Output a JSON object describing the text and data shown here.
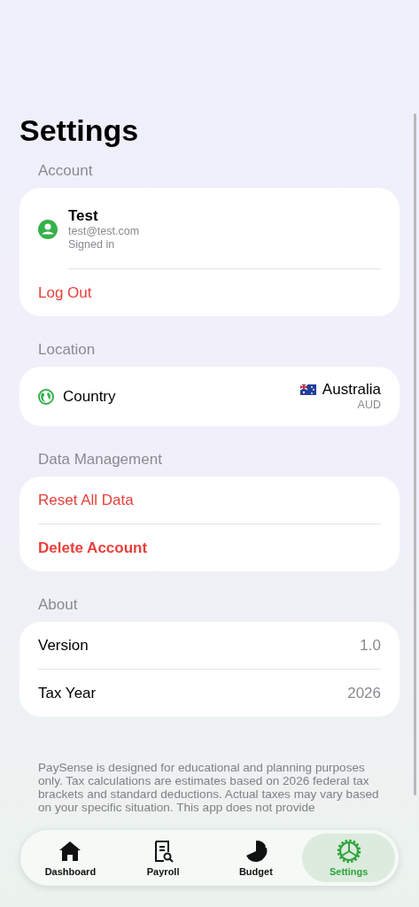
{
  "title": "Settings",
  "sections": [
    {
      "header": "Account",
      "rows": [
        {
          "kind": "profile",
          "name": "Test",
          "email": "test@test.com",
          "status": "Signed in"
        },
        {
          "kind": "action",
          "label": "Log Out",
          "bold": false
        }
      ]
    },
    {
      "header": "Location",
      "rows": [
        {
          "kind": "country",
          "label": "Country",
          "value": "Australia",
          "sub": "AUD"
        }
      ]
    },
    {
      "header": "Data Management",
      "rows": [
        {
          "kind": "action",
          "label": "Reset All Data",
          "bold": false
        },
        {
          "kind": "action",
          "label": "Delete Account",
          "bold": true
        }
      ]
    },
    {
      "header": "About",
      "rows": [
        {
          "kind": "info",
          "label": "Version",
          "value": "1.0"
        },
        {
          "kind": "info",
          "label": "Tax Year",
          "value": "2026"
        }
      ]
    }
  ],
  "disclaimer": "PaySense is designed for educational and planning purposes only. Tax calculations are estimates based on 2026 federal tax brackets and standard deductions. Actual taxes may vary based on your specific situation. This app does not provide",
  "tabs": [
    {
      "kind": "home",
      "label": "Dashboard",
      "selected": false
    },
    {
      "kind": "document",
      "label": "Payroll",
      "selected": false
    },
    {
      "kind": "pie",
      "label": "Budget",
      "selected": false
    },
    {
      "kind": "gear",
      "label": "Settings",
      "selected": true
    }
  ]
}
